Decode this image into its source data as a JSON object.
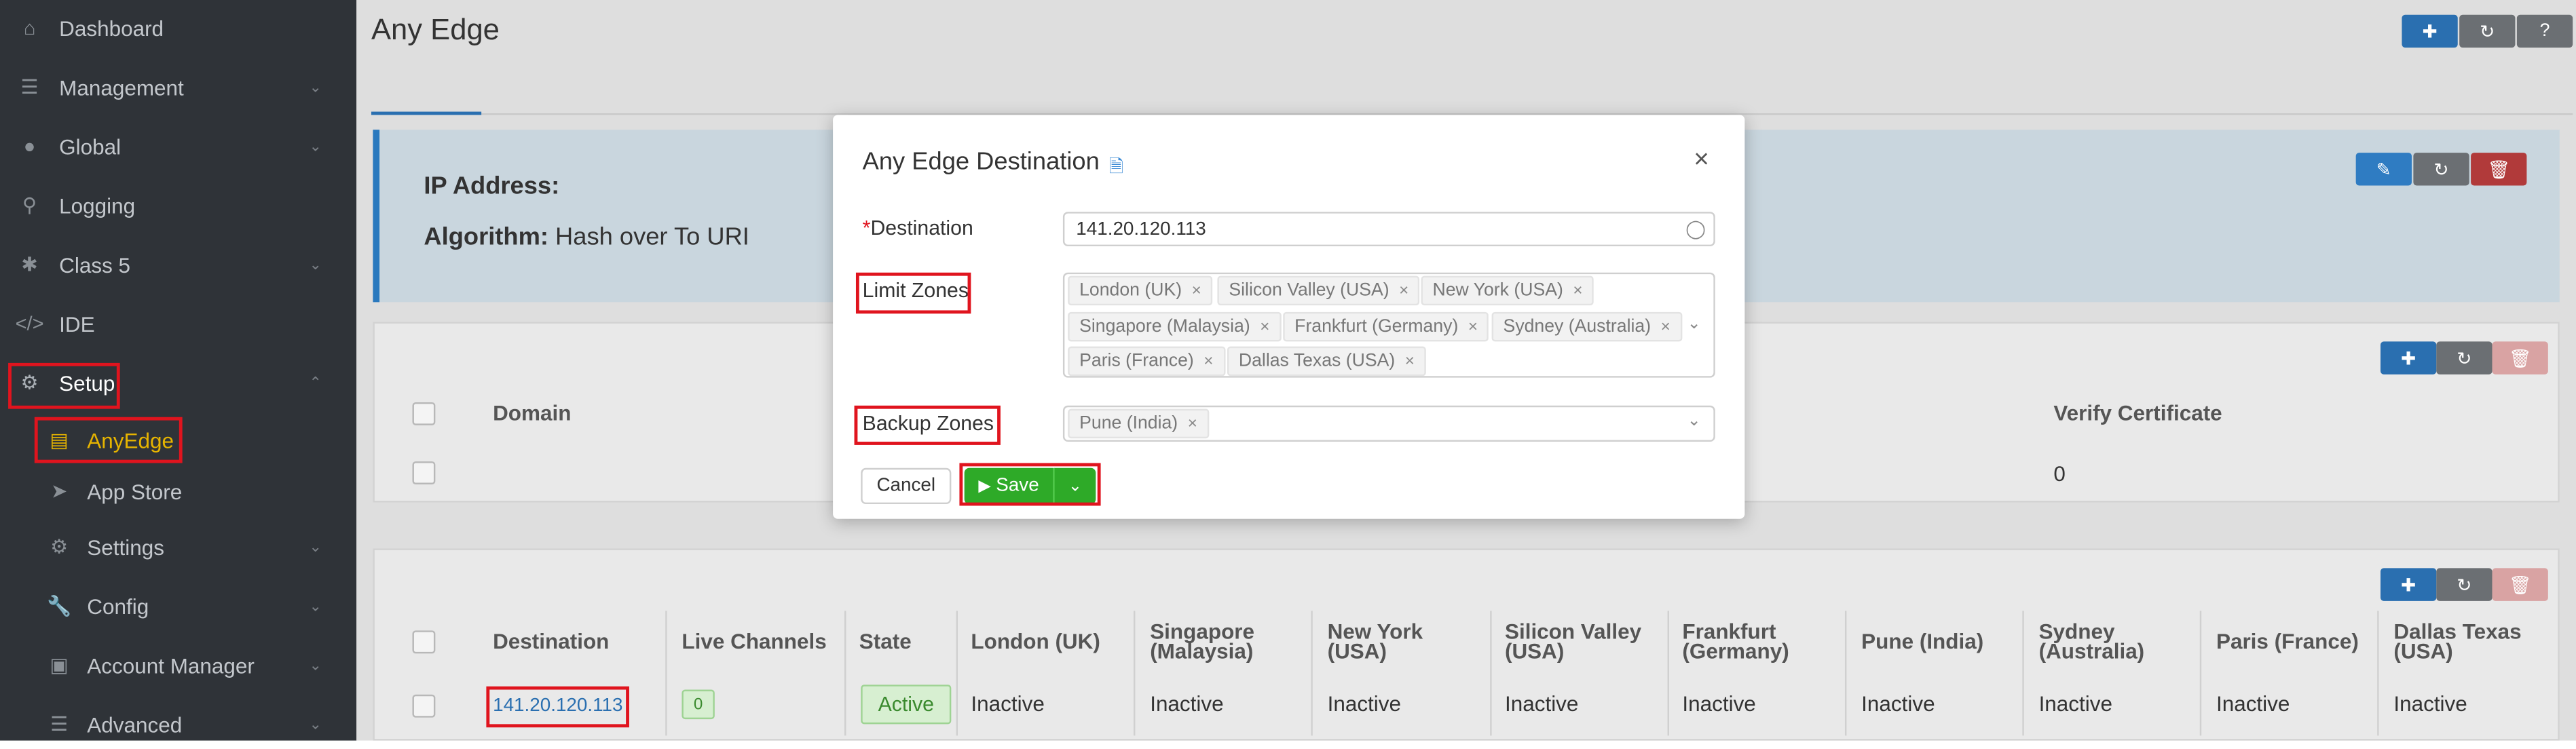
{
  "sidebar": {
    "items": [
      {
        "label": "Dashboard",
        "icon": "home-icon"
      },
      {
        "label": "Management",
        "icon": "list-icon"
      },
      {
        "label": "Global",
        "icon": "globe-icon"
      },
      {
        "label": "Logging",
        "icon": "search-icon"
      },
      {
        "label": "Class 5",
        "icon": "asterisk-icon"
      },
      {
        "label": "IDE",
        "icon": "code-icon"
      },
      {
        "label": "Setup",
        "icon": "cogs-icon"
      },
      {
        "label": "AnyEdge",
        "icon": "server-icon"
      },
      {
        "label": "App Store",
        "icon": "rocket-icon"
      },
      {
        "label": "Settings",
        "icon": "gear-icon"
      },
      {
        "label": "Config",
        "icon": "wrench-icon"
      },
      {
        "label": "Account Manager",
        "icon": "lock-icon"
      },
      {
        "label": "Advanced",
        "icon": "sliders-icon"
      }
    ]
  },
  "main": {
    "title": "Any Edge",
    "ip_label": "IP Address:",
    "algorithm_label": "Algorithm:",
    "algorithm_value": "Hash over To URI"
  },
  "domain_table": {
    "headers": [
      "Domain",
      "Verify Certificate"
    ],
    "rows": [
      {
        "verify_certificate": "0"
      }
    ]
  },
  "dest_table": {
    "headers": [
      "Destination",
      "Live Channels",
      "State",
      "London (UK)",
      "Singapore (Malaysia)",
      "New York (USA)",
      "Silicon Valley (USA)",
      "Frankfurt (Germany)",
      "Pune (India)",
      "Sydney (Australia)",
      "Paris (France)",
      "Dallas Texas (USA)"
    ],
    "row": {
      "destination": "141.20.120.113",
      "live_channels": "0",
      "state": "Active",
      "zones": [
        "Inactive",
        "Inactive",
        "Inactive",
        "Inactive",
        "Inactive",
        "Inactive",
        "Inactive",
        "Inactive",
        "Inactive"
      ]
    }
  },
  "modal": {
    "title": "Any Edge Destination",
    "destination_label": "Destination",
    "required_mark": "*",
    "destination_value": "141.20.120.113",
    "limit_zones_label": "Limit Zones",
    "limit_zones": [
      "London (UK)",
      "Silicon Valley (USA)",
      "New York (USA)",
      "Singapore (Malaysia)",
      "Frankfurt (Germany)",
      "Sydney (Australia)",
      "Paris (France)",
      "Dallas Texas (USA)"
    ],
    "backup_zones_label": "Backup Zones",
    "backup_zones": [
      "Pune (India)"
    ],
    "cancel_label": "Cancel",
    "save_label": "Save",
    "close_glyph": "×",
    "chip_remove_glyph": "×"
  },
  "colors": {
    "sidebar_bg": "#2f3338",
    "accent_blue": "#2a6fb0",
    "save_green": "#2eaa28",
    "highlight_red": "#e0141e",
    "active_yellow": "#e6b400"
  }
}
